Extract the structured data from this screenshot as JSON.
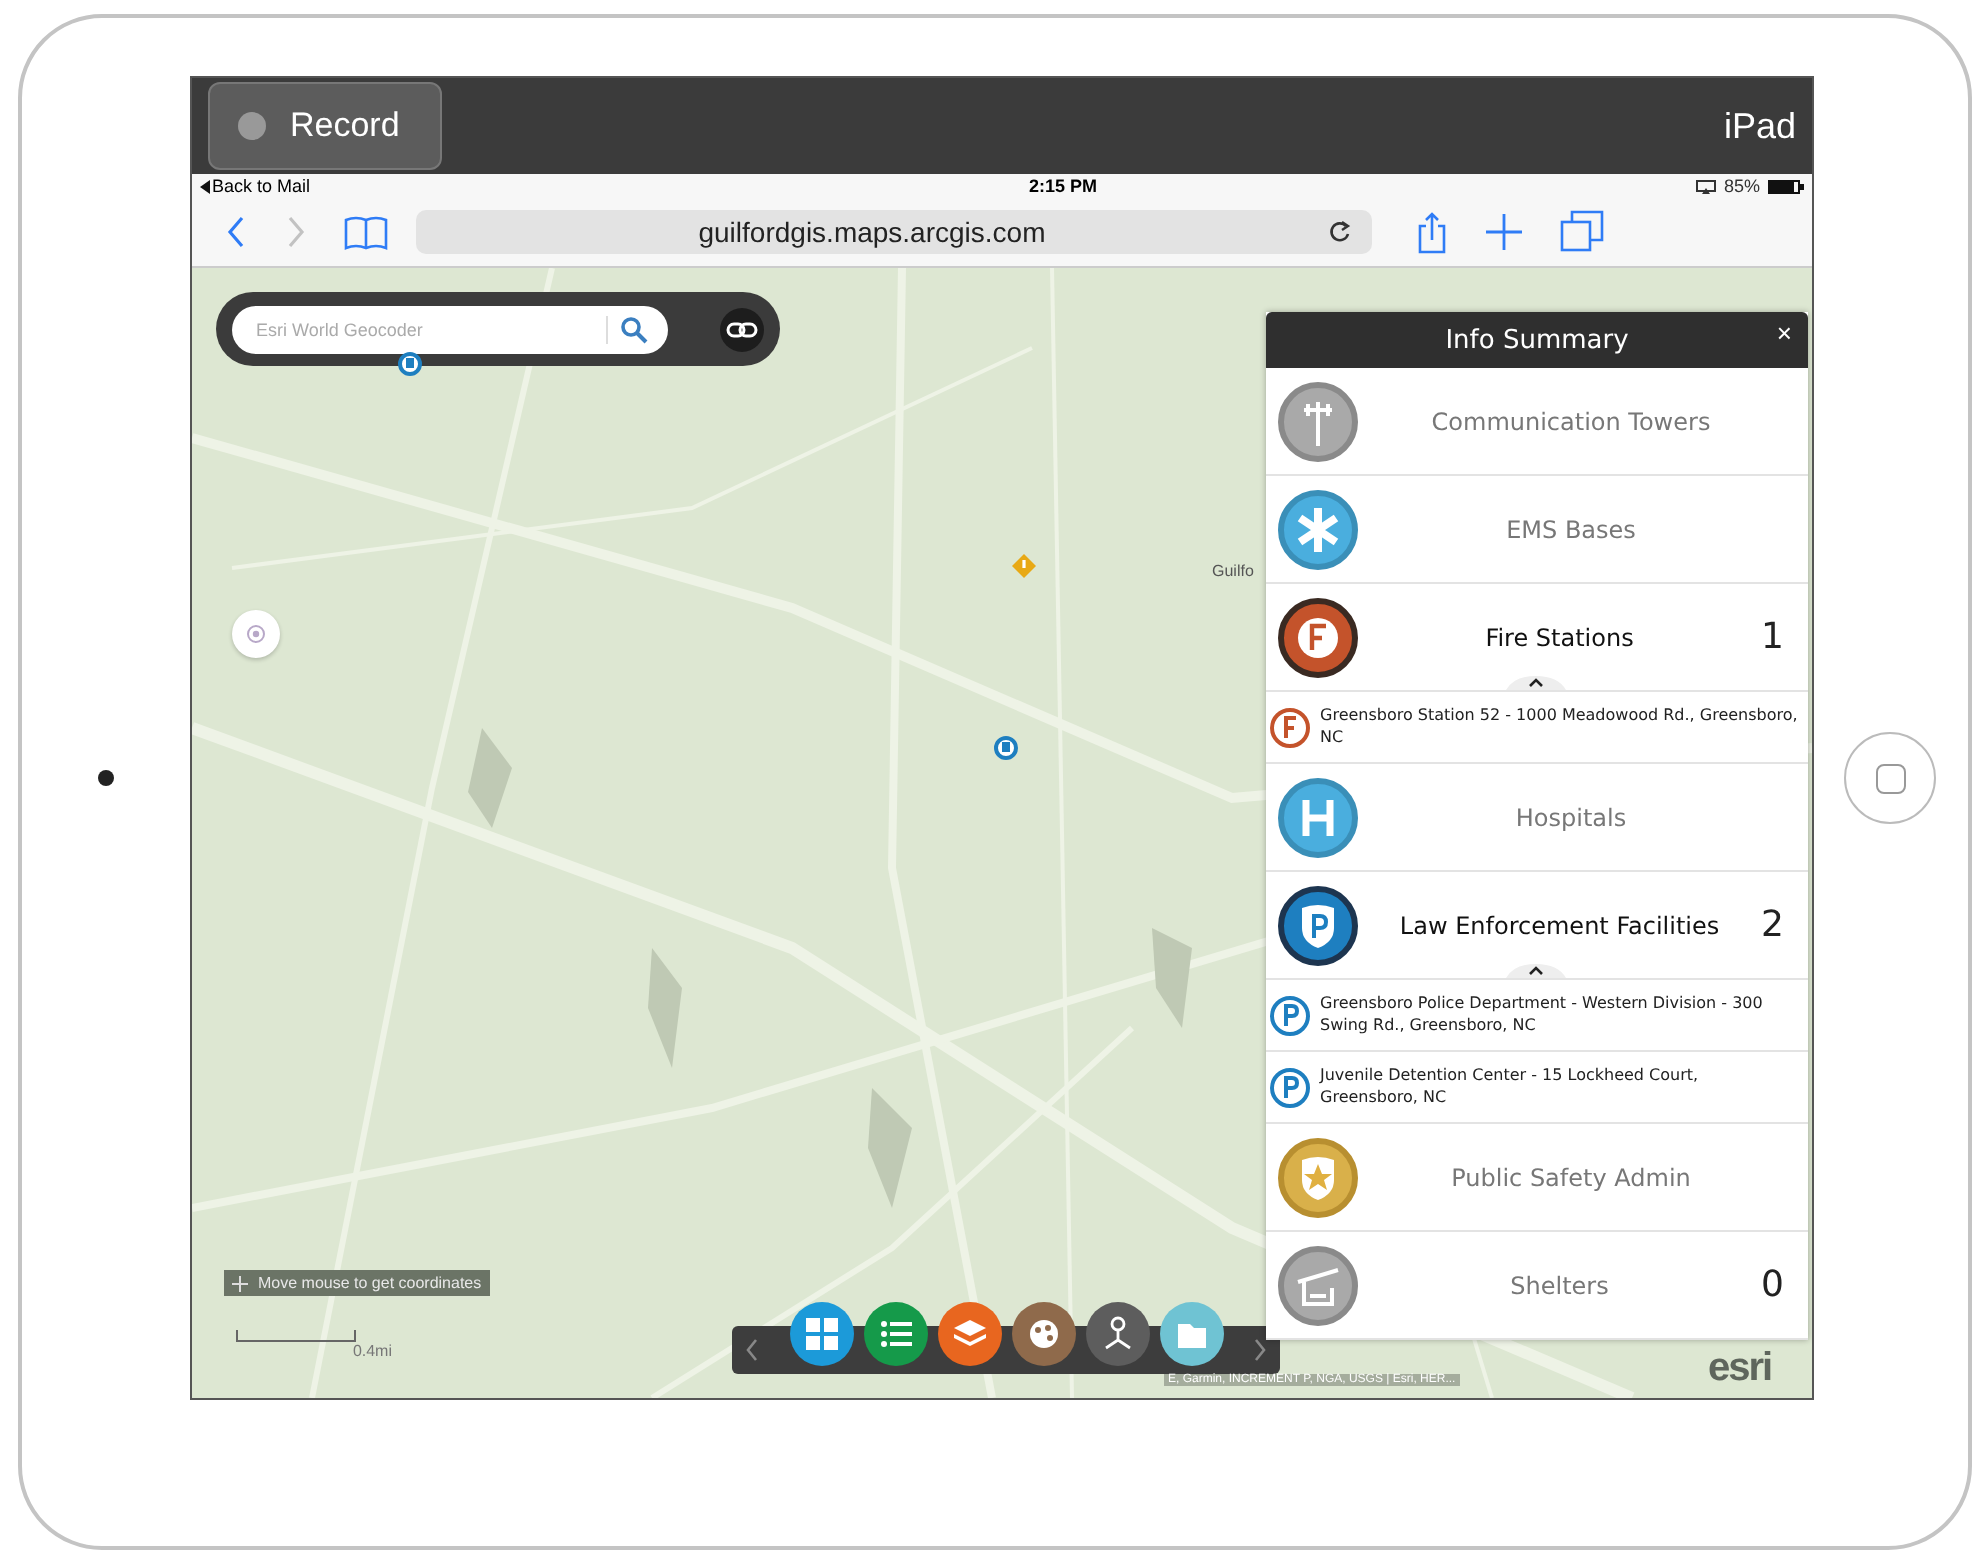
{
  "recorder": {
    "button": "Record",
    "device": "iPad"
  },
  "status_bar": {
    "back": "Back to Mail",
    "time": "2:15 PM",
    "battery": "85%"
  },
  "browser": {
    "url": "guilfordgis.maps.arcgis.com"
  },
  "map": {
    "search_placeholder": "Esri World Geocoder",
    "place_label": "Guilfo",
    "coordinates": "Move mouse to get coordinates",
    "scale": "0.4mi",
    "attribution": "E, Garmin, INCREMENT P, NGA, USGS | Esri, HER...",
    "logo": "esri"
  },
  "toolbar": [
    {
      "kind": "grid",
      "color": "#1c9ad9"
    },
    {
      "kind": "list",
      "color": "#159a4a"
    },
    {
      "kind": "layers",
      "color": "#e8661f"
    },
    {
      "kind": "palette",
      "color": "#8f6a4b"
    },
    {
      "kind": "network",
      "color": "#5d5d5d"
    },
    {
      "kind": "folder",
      "color": "#6fc3d3"
    }
  ],
  "info_summary": {
    "title": "Info Summary",
    "close": "×",
    "layers": [
      {
        "name": "Communication Towers",
        "kind": "tower",
        "active": false,
        "expanded": false
      },
      {
        "name": "EMS Bases",
        "kind": "ems",
        "active": false,
        "expanded": false
      },
      {
        "name": "Fire Stations",
        "kind": "fire",
        "active": true,
        "count": "1",
        "expanded": true,
        "features": [
          "Greensboro Station 52 - 1000 Meadowood Rd., Greensboro, NC"
        ]
      },
      {
        "name": "Hospitals",
        "kind": "hospital",
        "active": false,
        "expanded": false
      },
      {
        "name": "Law Enforcement Facilities",
        "kind": "police",
        "active": true,
        "count": "2",
        "expanded": true,
        "features": [
          "Greensboro Police Department - Western Division - 300 Swing Rd., Greensboro, NC",
          "Juvenile Detention Center - 15 Lockheed Court, Greensboro, NC"
        ]
      },
      {
        "name": "Public Safety Admin",
        "kind": "admin",
        "active": false,
        "expanded": false
      },
      {
        "name": "Shelters",
        "kind": "shelter",
        "active": false,
        "count": "0",
        "expanded": false
      }
    ]
  }
}
